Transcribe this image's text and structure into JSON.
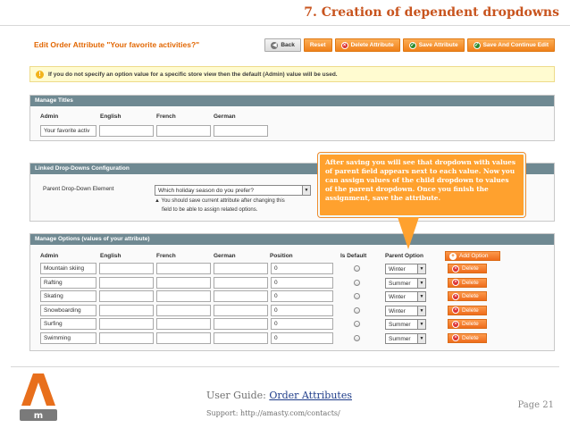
{
  "slide": {
    "title": "7. Creation of dependent dropdowns",
    "footer": {
      "guide_prefix": "User Guide: ",
      "guide_link": "Order Attributes",
      "support": "Support: http://amasty.com/contacts/",
      "page": "Page 21"
    }
  },
  "page": {
    "title": "Edit Order Attribute \"Your favorite activities?\"",
    "buttons": {
      "back": "Back",
      "reset": "Reset",
      "delete": "Delete Attribute",
      "save": "Save Attribute",
      "save_continue": "Save And Continue Edit"
    },
    "notice": "If you do not specify an option value for a specific store view then the default (Admin) value will be used."
  },
  "titles": {
    "heading": "Manage Titles",
    "columns": [
      "Admin",
      "English",
      "French",
      "German"
    ],
    "admin_value": "Your favorite activ"
  },
  "linked": {
    "heading": "Linked Drop-Downs Configuration",
    "label": "Parent Drop-Down Element",
    "selected": "Which holiday season do you prefer?",
    "note_line1": "You should save current attribute after changing this",
    "note_line2": "field to be able to assign related options."
  },
  "options": {
    "heading": "Manage Options (values of your attribute)",
    "columns": {
      "admin": "Admin",
      "english": "English",
      "french": "French",
      "german": "German",
      "position": "Position",
      "is_default": "Is Default",
      "parent": "Parent Option"
    },
    "add_label": "Add Option",
    "delete_label": "Delete",
    "rows": [
      {
        "admin": "Mountain skiing",
        "position": "0",
        "parent": "Winter"
      },
      {
        "admin": "Rafting",
        "position": "0",
        "parent": "Summer"
      },
      {
        "admin": "Skating",
        "position": "0",
        "parent": "Winter"
      },
      {
        "admin": "Snowboarding",
        "position": "0",
        "parent": "Winter"
      },
      {
        "admin": "Surfing",
        "position": "0",
        "parent": "Summer"
      },
      {
        "admin": "Swimming",
        "position": "0",
        "parent": "Summer"
      }
    ]
  },
  "callout": "After saving you will see that dropdown with values of parent field appears next to each value. Now you can assign values of the child dropdown to values of the parent dropdown. Once you finish the assignment, save the attribute.",
  "icons": {
    "back": "back-arrow-icon",
    "delete": "delete-x-icon",
    "save": "check-icon",
    "add": "plus-icon",
    "notice": "warning-icon"
  },
  "colors": {
    "accent_orange": "#e26703",
    "button_orange": "#f0801a",
    "fieldset_header": "#6f8992",
    "callout": "#ffa12e",
    "slide_title": "#c8541e"
  }
}
